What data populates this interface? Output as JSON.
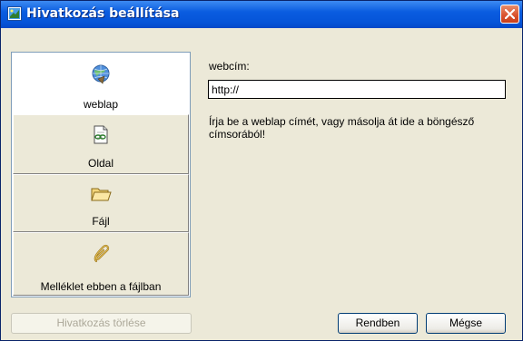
{
  "window": {
    "title": "Hivatkozás beállítása",
    "title_icon": "link-dialog-icon",
    "close_icon": "close-icon"
  },
  "nav": {
    "items": [
      {
        "label": "weblap",
        "icon": "globe-icon",
        "selected": true
      },
      {
        "label": "Oldal",
        "icon": "page-link-icon",
        "selected": false
      },
      {
        "label": "Fájl",
        "icon": "folder-icon",
        "selected": false
      },
      {
        "label": "Melléklet ebben a fájlban",
        "icon": "paperclip-icon",
        "selected": false
      }
    ]
  },
  "form": {
    "url_label": "webcím:",
    "url_value": "http://",
    "hint": "Írja be a weblap címét, vagy másolja át ide a böngésző címsorából!"
  },
  "buttons": {
    "remove_link": "Hivatkozás törlése",
    "ok": "Rendben",
    "cancel": "Mégse"
  },
  "colors": {
    "titlebar": "#0554d8",
    "dialog_bg": "#ece9d8",
    "close": "#d9502c"
  }
}
